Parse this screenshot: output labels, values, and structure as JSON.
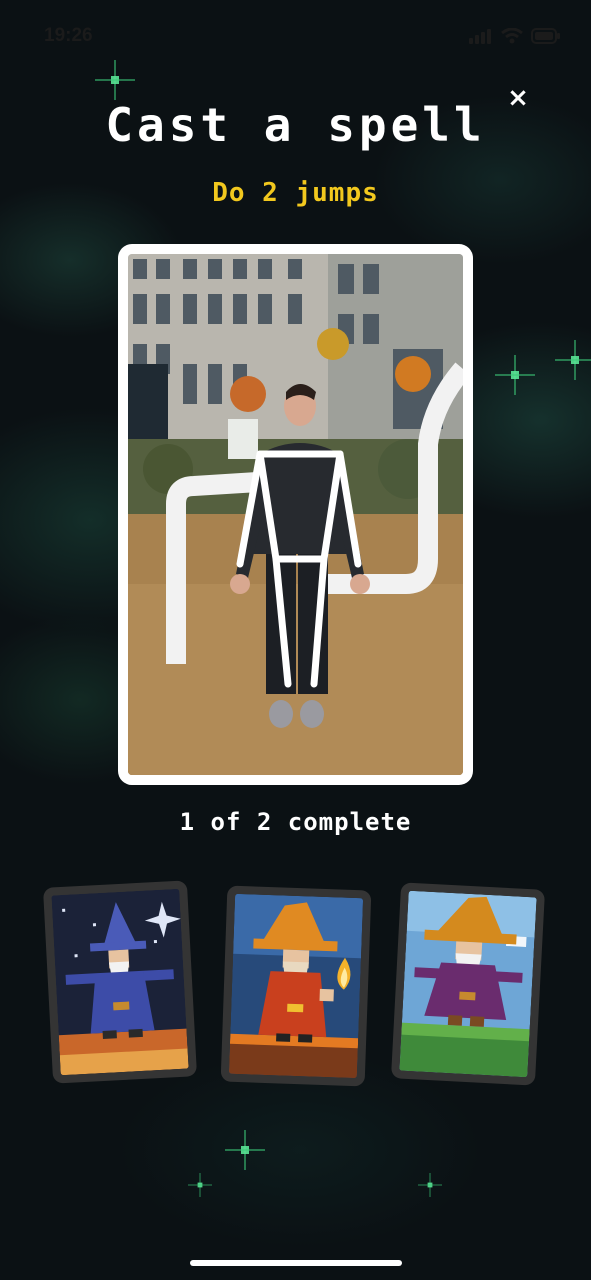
{
  "status_bar": {
    "time": "19:26"
  },
  "header": {
    "title": "Cast a spell",
    "task": "Do 2 jumps",
    "close_label": "×"
  },
  "progress": {
    "text": "1 of 2 complete",
    "completed": 1,
    "total": 2
  },
  "cards": [
    {
      "name": "blue-wizard-card",
      "icon": "wizard-blue"
    },
    {
      "name": "fire-wizard-card",
      "icon": "wizard-fire"
    },
    {
      "name": "purple-wizard-card",
      "icon": "wizard-purple"
    }
  ],
  "colors": {
    "accent_yellow": "#f2c81e",
    "background": "#0b1114",
    "card_frame": "#343434"
  }
}
